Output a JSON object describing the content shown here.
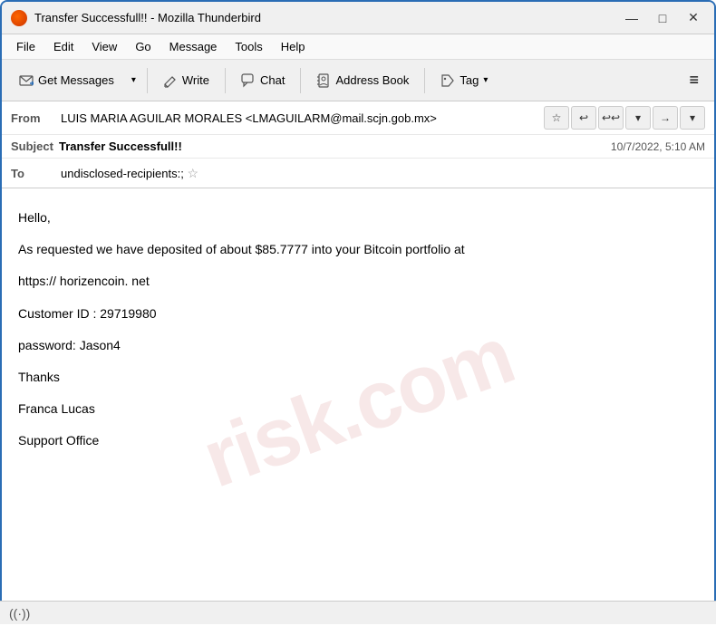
{
  "titlebar": {
    "title": "Transfer Successfull!! - Mozilla Thunderbird",
    "minimize": "—",
    "maximize": "□",
    "close": "✕"
  },
  "menubar": {
    "items": [
      "File",
      "Edit",
      "View",
      "Go",
      "Message",
      "Tools",
      "Help"
    ]
  },
  "toolbar": {
    "get_messages_label": "Get Messages",
    "write_label": "Write",
    "chat_label": "Chat",
    "address_book_label": "Address Book",
    "tag_label": "Tag",
    "menu_icon": "≡"
  },
  "email": {
    "from_label": "From",
    "from_value": "LUIS MARIA AGUILAR MORALES <LMAGUILARM@mail.scjn.gob.mx>",
    "subject_label": "Subject",
    "subject_value": "Transfer Successfull!!",
    "date": "10/7/2022, 5:10 AM",
    "to_label": "To",
    "to_value": "undisclosed-recipients:;"
  },
  "body": {
    "line1": "Hello,",
    "line2": "As requested we have deposited of about $85.7777 into your Bitcoin portfolio at",
    "line3": "https:// horizencoin. net",
    "line4": "Customer ID : 29719980",
    "line5": "password:    Jason4",
    "line6": "Thanks",
    "line7": "Franca Lucas",
    "line8": "Support Office"
  },
  "watermark": {
    "text": "risk.com"
  },
  "statusbar": {
    "icon": "((·))"
  }
}
